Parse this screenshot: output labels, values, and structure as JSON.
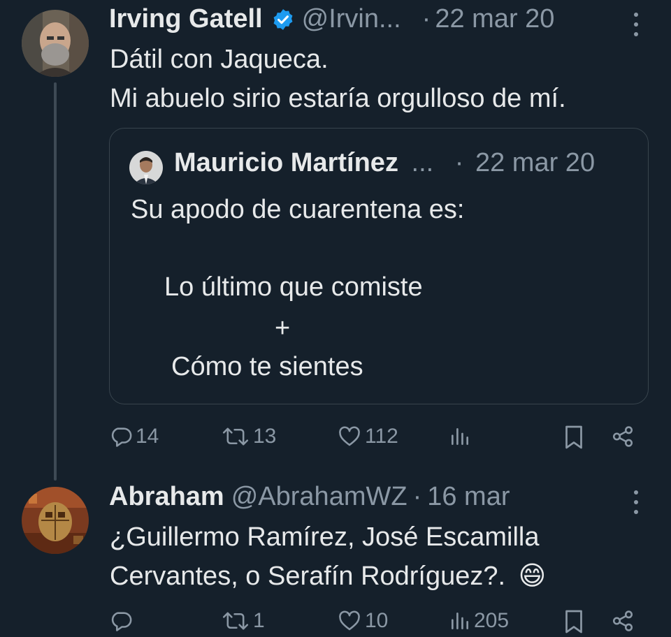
{
  "colors": {
    "background": "#15202b",
    "text": "#e7e9ea",
    "muted": "#8b98a5",
    "verified": "#1d9bf0"
  },
  "tweet1": {
    "name": "Irving Gatell",
    "handle": "@Irvin...",
    "sep": "·",
    "date": "22 mar 20",
    "lines": [
      "Dátil con Jaqueca.",
      "Mi abuelo sirio estaría orgulloso de mí."
    ],
    "quote": {
      "name": "Mauricio Martínez",
      "ellipsis": "...",
      "sep": "·",
      "date": "22 mar 20",
      "lines": [
        "Su apodo de cuarentena es:",
        "Lo último que comiste",
        "+",
        "Cómo te sientes"
      ]
    },
    "stats": {
      "replies": "14",
      "retweets": "13",
      "likes": "112"
    }
  },
  "tweet2": {
    "name": "Abraham",
    "handle": "@AbrahamWZ",
    "sep": "·",
    "date": "16 mar",
    "lines": [
      "¿Guillermo Ramírez, José Escamilla",
      "Cervantes, o Serafín Rodríguez?."
    ],
    "emoji": "😄",
    "stats": {
      "replies": "",
      "retweets": "1",
      "likes": "10",
      "views": "205"
    }
  },
  "icons": [
    "more-icon",
    "verified-icon",
    "reply-icon",
    "retweet-icon",
    "like-icon",
    "views-icon",
    "bookmark-icon",
    "share-icon"
  ]
}
